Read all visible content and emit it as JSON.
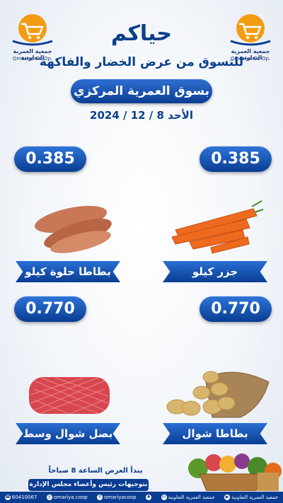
{
  "header": {
    "logo_left": {
      "name_ar": "جمعية العمرية التعاونية",
      "name_en": "Omariya Co-Op."
    },
    "logo_right": {
      "name_ar": "جمعية العمرية التعاونية",
      "name_en": "Omariya Co-Op."
    },
    "greeting": "حياكم",
    "subtitle": "للتسوق من عرض الخضار والفاكهة",
    "market": "بسوق العمرية المركزي",
    "date": "الأحد 8 / 12 / 2024"
  },
  "products": [
    {
      "price": "0.385",
      "label": "جزر كيلو",
      "icon": "carrots-image"
    },
    {
      "price": "0.385",
      "label": "بطاطا حلوة كيلو",
      "icon": "sweet-potato-image"
    },
    {
      "price": "0.770",
      "label": "بطاطا شوال",
      "icon": "potato-sack-image"
    },
    {
      "price": "0.770",
      "label": "بصل شوال وسط",
      "icon": "onion-sack-image"
    }
  ],
  "footer": {
    "start_note": "يبدأ العرض الساعة 8 صباحاً",
    "board_note": "بتوجيهات رئيس وأعضاء مجلس الإدارة"
  },
  "social": [
    {
      "icon": "phone-icon",
      "text": "60410067"
    },
    {
      "icon": "instagram-icon",
      "text": "omariya.coop"
    },
    {
      "icon": "x-icon",
      "text": "omariyacoop"
    },
    {
      "icon": "snapchat-icon",
      "text": ""
    },
    {
      "icon": "linkedin-icon",
      "text": "جمعية العمرية التعاونية"
    },
    {
      "icon": "youtube-icon",
      "text": "جمعية العمرية التعاونية"
    }
  ],
  "colors": {
    "brand_blue": "#0a3d92",
    "accent_orange": "#f39c12",
    "accent_light": "#2f6fd3"
  }
}
